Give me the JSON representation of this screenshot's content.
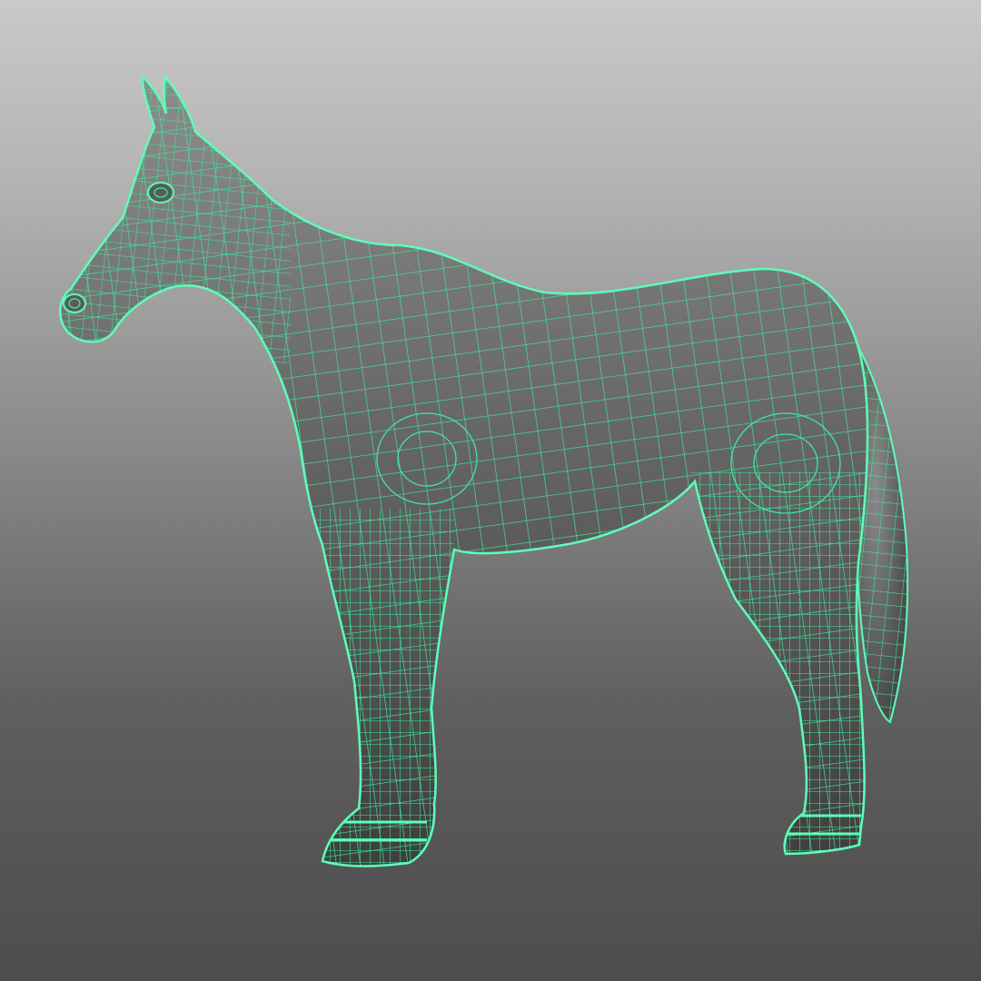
{
  "viewport": {
    "model_name": "horse-wireframe",
    "shading": "wireframe-on-shaded",
    "colors": {
      "bg_top": "#c9c9c9",
      "bg_bottom": "#4d4d4d",
      "wire": "#3ee8a0",
      "wire_outline": "#5dffb8",
      "surface_light": "#8c8c8c",
      "surface_dark": "#3e3e3e"
    }
  }
}
